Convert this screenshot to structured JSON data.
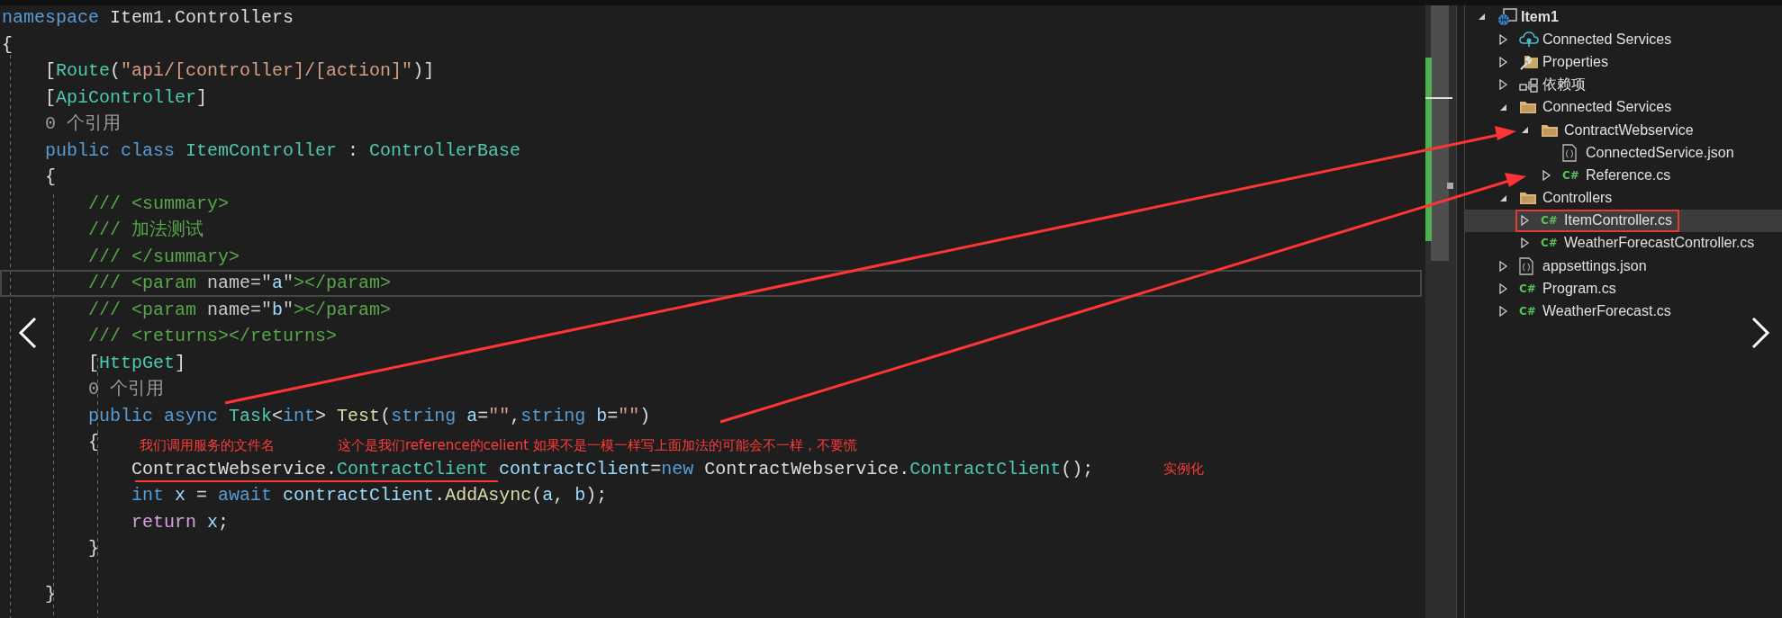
{
  "editor": {
    "lines": [
      {
        "tokens": [
          {
            "kind": "kw",
            "text": "namespace"
          },
          {
            "kind": "plain",
            "text": " Item1.Controllers"
          }
        ]
      },
      {
        "tokens": [
          {
            "kind": "plain",
            "text": "{"
          }
        ]
      },
      {
        "tokens": [
          {
            "kind": "plain",
            "text": "    ["
          },
          {
            "kind": "type",
            "text": "Route"
          },
          {
            "kind": "plain",
            "text": "("
          },
          {
            "kind": "string",
            "text": "\"api/[controller]/[action]\""
          },
          {
            "kind": "plain",
            "text": ")]"
          }
        ]
      },
      {
        "tokens": [
          {
            "kind": "plain",
            "text": "    ["
          },
          {
            "kind": "type",
            "text": "ApiController"
          },
          {
            "kind": "plain",
            "text": "]"
          }
        ]
      },
      {
        "tokens": [
          {
            "kind": "lens",
            "text": "    0 个引用"
          }
        ]
      },
      {
        "tokens": [
          {
            "kind": "kw",
            "text": "    public class "
          },
          {
            "kind": "type",
            "text": "ItemController"
          },
          {
            "kind": "plain",
            "text": " : "
          },
          {
            "kind": "type",
            "text": "ControllerBase"
          }
        ]
      },
      {
        "tokens": [
          {
            "kind": "plain",
            "text": "    {"
          }
        ]
      },
      {
        "tokens": [
          {
            "kind": "comment",
            "text": "        /// <summary>"
          }
        ]
      },
      {
        "tokens": [
          {
            "kind": "comment",
            "text": "        /// 加法测试"
          }
        ]
      },
      {
        "tokens": [
          {
            "kind": "comment",
            "text": "        /// </summary>"
          }
        ]
      },
      {
        "current": true,
        "tokens": [
          {
            "kind": "comment",
            "text": "        /// <param "
          },
          {
            "kind": "docattr",
            "text": "name=\""
          },
          {
            "kind": "docvalue",
            "text": "a"
          },
          {
            "kind": "docattr",
            "text": "\""
          },
          {
            "kind": "comment",
            "text": "></param>"
          }
        ]
      },
      {
        "tokens": [
          {
            "kind": "comment",
            "text": "        /// <param "
          },
          {
            "kind": "docattr",
            "text": "name=\""
          },
          {
            "kind": "docvalue",
            "text": "b"
          },
          {
            "kind": "docattr",
            "text": "\""
          },
          {
            "kind": "comment",
            "text": "></param>"
          }
        ]
      },
      {
        "tokens": [
          {
            "kind": "comment",
            "text": "        /// <returns></returns>"
          }
        ]
      },
      {
        "tokens": [
          {
            "kind": "plain",
            "text": "        ["
          },
          {
            "kind": "type",
            "text": "HttpGet"
          },
          {
            "kind": "plain",
            "text": "]"
          }
        ]
      },
      {
        "tokens": [
          {
            "kind": "lens",
            "text": "        0 个引用"
          }
        ]
      },
      {
        "tokens": [
          {
            "kind": "kw",
            "text": "        public async "
          },
          {
            "kind": "type",
            "text": "Task"
          },
          {
            "kind": "plain",
            "text": "<"
          },
          {
            "kind": "kw",
            "text": "int"
          },
          {
            "kind": "plain",
            "text": "> "
          },
          {
            "kind": "method",
            "text": "Test"
          },
          {
            "kind": "plain",
            "text": "("
          },
          {
            "kind": "kw",
            "text": "string "
          },
          {
            "kind": "var",
            "text": "a"
          },
          {
            "kind": "plain",
            "text": "="
          },
          {
            "kind": "string",
            "text": "\"\""
          },
          {
            "kind": "plain",
            "text": ","
          },
          {
            "kind": "kw",
            "text": "string "
          },
          {
            "kind": "var",
            "text": "b"
          },
          {
            "kind": "plain",
            "text": "="
          },
          {
            "kind": "string",
            "text": "\"\""
          },
          {
            "kind": "plain",
            "text": ")"
          }
        ]
      },
      {
        "tokens": [
          {
            "kind": "plain",
            "text": "        {"
          }
        ]
      },
      {
        "tokens": [
          {
            "kind": "plain",
            "text": "            ContractWebservice."
          },
          {
            "kind": "type",
            "text": "ContractClient"
          },
          {
            "kind": "var",
            "text": " contractClient"
          },
          {
            "kind": "plain",
            "text": "="
          },
          {
            "kind": "kw",
            "text": "new"
          },
          {
            "kind": "plain",
            "text": " ContractWebservice."
          },
          {
            "kind": "type",
            "text": "ContractClient"
          },
          {
            "kind": "plain",
            "text": "();"
          }
        ]
      },
      {
        "tokens": [
          {
            "kind": "kw",
            "text": "            int "
          },
          {
            "kind": "var",
            "text": "x"
          },
          {
            "kind": "plain",
            "text": " = "
          },
          {
            "kind": "kw",
            "text": "await "
          },
          {
            "kind": "var",
            "text": "contractClient"
          },
          {
            "kind": "plain",
            "text": "."
          },
          {
            "kind": "method",
            "text": "AddAsync"
          },
          {
            "kind": "plain",
            "text": "("
          },
          {
            "kind": "var",
            "text": "a"
          },
          {
            "kind": "plain",
            "text": ", "
          },
          {
            "kind": "var",
            "text": "b"
          },
          {
            "kind": "plain",
            "text": ");"
          }
        ]
      },
      {
        "tokens": [
          {
            "kind": "control",
            "text": "            return "
          },
          {
            "kind": "var",
            "text": "x"
          },
          {
            "kind": "plain",
            "text": ";"
          }
        ]
      },
      {
        "tokens": [
          {
            "kind": "plain",
            "text": "        }"
          }
        ]
      },
      {
        "gap_before": true,
        "tokens": [
          {
            "kind": "plain",
            "text": "    }"
          }
        ]
      }
    ]
  },
  "annotations": [
    {
      "text": "我们调用服务的文件名"
    },
    {
      "text": "这个是我们reference的celient 如果不是一模一样写上面加法的可能会不一样，不要慌"
    },
    {
      "text": "实例化"
    }
  ],
  "explorer": {
    "items": [
      {
        "label": "Item1",
        "kind": "project",
        "expanded": true,
        "selected": false,
        "boxed": false,
        "children": [
          {
            "label": "Connected Services",
            "kind": "cloud",
            "expanded": false,
            "selected": false,
            "boxed": false
          },
          {
            "label": "Properties",
            "kind": "properties",
            "expanded": false,
            "selected": false,
            "boxed": false
          },
          {
            "label": "依赖项",
            "kind": "dependencies",
            "expanded": false,
            "selected": false,
            "boxed": false
          },
          {
            "label": "Connected Services",
            "kind": "folder",
            "expanded": true,
            "selected": false,
            "boxed": false,
            "children": [
              {
                "label": "ContractWebservice",
                "kind": "folder",
                "expanded": true,
                "selected": false,
                "boxed": false,
                "children": [
                  {
                    "label": "ConnectedService.json",
                    "kind": "json",
                    "leaf": true,
                    "selected": false,
                    "boxed": false
                  },
                  {
                    "label": "Reference.cs",
                    "kind": "csharp",
                    "badge": "C#",
                    "expanded": false,
                    "selected": false,
                    "boxed": false
                  }
                ]
              }
            ]
          },
          {
            "label": "Controllers",
            "kind": "folder",
            "expanded": true,
            "selected": false,
            "boxed": false,
            "children": [
              {
                "label": "ItemController.cs",
                "kind": "csharp",
                "badge": "C#",
                "expanded": false,
                "selected": true,
                "boxed": true
              },
              {
                "label": "WeatherForecastController.cs",
                "kind": "csharp",
                "badge": "C#",
                "expanded": false,
                "selected": false,
                "boxed": false
              }
            ]
          },
          {
            "label": "appsettings.json",
            "kind": "json",
            "expanded": false,
            "selected": false,
            "boxed": false
          },
          {
            "label": "Program.cs",
            "kind": "csharp",
            "badge": "C#",
            "expanded": false,
            "selected": false,
            "boxed": false
          },
          {
            "label": "WeatherForecast.cs",
            "kind": "csharp",
            "badge": "C#",
            "expanded": false,
            "selected": false,
            "boxed": false
          }
        ]
      }
    ]
  }
}
